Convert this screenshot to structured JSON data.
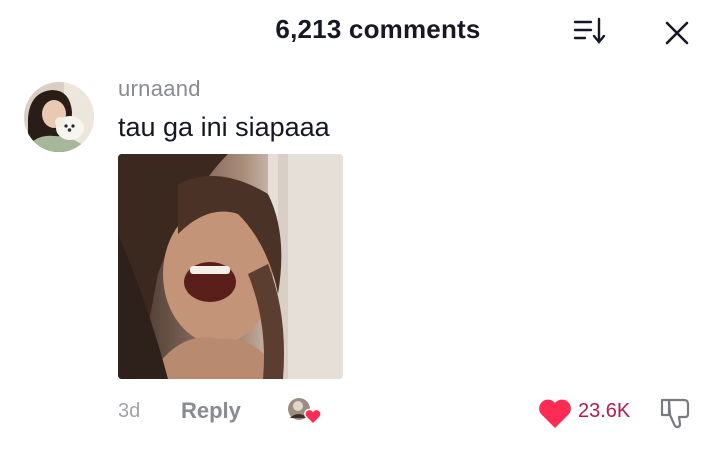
{
  "header": {
    "title": "6,213 comments",
    "sort_icon": "sort-descending-icon",
    "close_icon": "close-icon"
  },
  "comment": {
    "username": "urnaand",
    "text": "tau ga ini siapaaa",
    "time": "3d",
    "reply_label": "Reply",
    "like_count": "23.6K",
    "liked": true
  },
  "colors": {
    "like_red": "#fe2c55",
    "like_count": "#b7194a",
    "username_gray": "#8a8b91",
    "text_dark": "#161823"
  }
}
